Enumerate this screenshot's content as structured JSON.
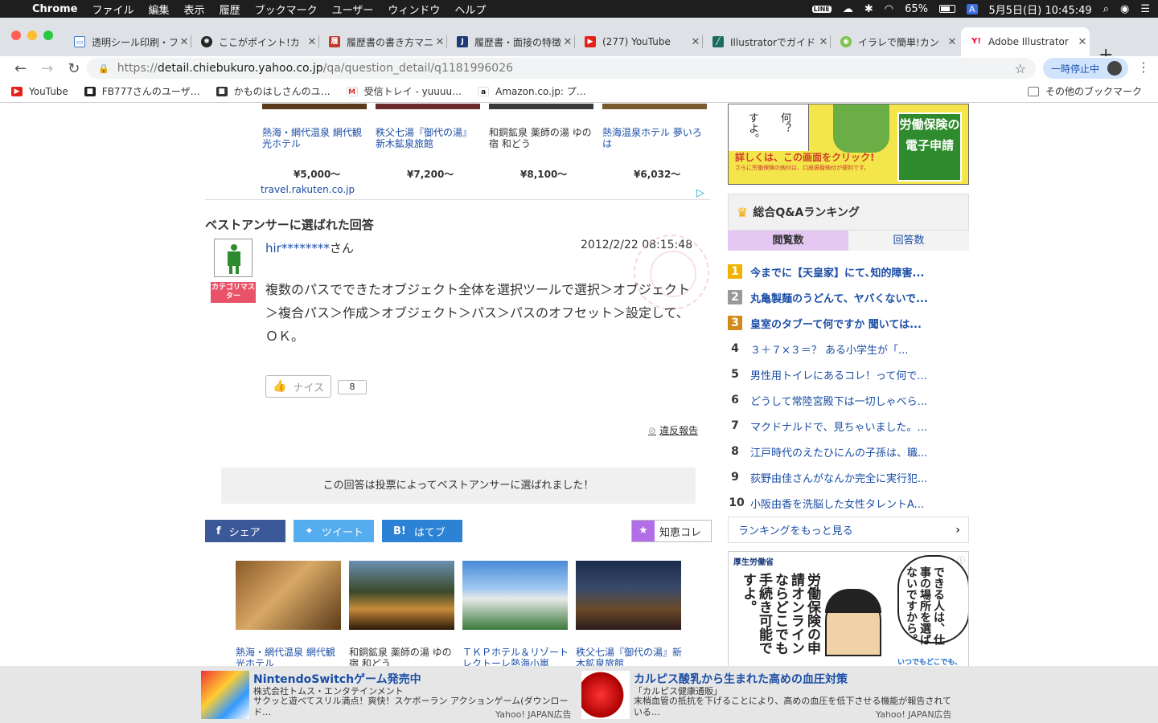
{
  "menubar": {
    "app": "Chrome",
    "items": [
      "ファイル",
      "編集",
      "表示",
      "履歴",
      "ブックマーク",
      "ユーザー",
      "ウィンドウ",
      "ヘルプ"
    ],
    "line_label": "LINE",
    "battery": "65%",
    "input_indicator": "A",
    "clock": "5月5日(日)  10:45:49"
  },
  "tabs": [
    {
      "title": "透明シール印刷・フ",
      "icon": "printing-favicon"
    },
    {
      "title": "ここがポイント!カ",
      "icon": "pinwheel-favicon"
    },
    {
      "title": "履歴書の書き方マニ",
      "icon": "resume-favicon"
    },
    {
      "title": "履歴書・面接の特徴",
      "icon": "j-favicon"
    },
    {
      "title": "(277) YouTube",
      "icon": "youtube-favicon"
    },
    {
      "title": "Illustratorでガイド",
      "icon": "illustrator-favicon"
    },
    {
      "title": "イラレで簡単!カン",
      "icon": "frog-favicon"
    },
    {
      "title": "Adobe Illustrator",
      "icon": "yahoo-favicon"
    }
  ],
  "address": {
    "scheme": "https://",
    "host": "detail.chiebukuro.yahoo.co.jp",
    "path": "/qa/question_detail/q1181996026"
  },
  "profile_button": "一時停止中",
  "bookmarks": [
    {
      "label": "YouTube",
      "icon": "youtube-icon"
    },
    {
      "label": "FB777さんのユーザ…",
      "icon": "fb777-icon"
    },
    {
      "label": "かものはしさんのユ…",
      "icon": "kamonohashi-icon"
    },
    {
      "label": "受信トレイ - yuuuu…",
      "icon": "gmail-icon"
    },
    {
      "label": "Amazon.co.jp: プ…",
      "icon": "amazon-icon"
    }
  ],
  "other_bookmarks": "その他のブックマーク",
  "travel_top": {
    "hotels": [
      {
        "name": "熱海・網代温泉 網代観光ホテル",
        "price": "¥5,000〜"
      },
      {
        "name": "秩父七湯『御代の湯』新木鉱泉旅館",
        "price": "¥7,200〜"
      },
      {
        "name": "和銅鉱泉 薬師の湯 ゆの宿 和どう",
        "price": "¥8,100〜"
      },
      {
        "name": "熱海温泉ホテル 夢いろは",
        "price": "¥6,032〜"
      }
    ],
    "source": "travel.rakuten.co.jp"
  },
  "best_answer": {
    "heading": "ベストアンサーに選ばれた回答",
    "badge": "カテゴリマスター",
    "user": "hir********",
    "suffix": "さん",
    "datetime": "2012/2/22  08:15:48",
    "body": "複数のパスでできたオブジェクト全体を選択ツールで選択＞オブジェクト＞複合パス＞作成＞オブジェクト＞パス＞パスのオフセット＞設定して、ＯＫ。",
    "nice_label": "ナイス",
    "nice_count": "8",
    "report": "違反報告",
    "vote_note": "この回答は投票によってベストアンサーに選ばれました！"
  },
  "share": {
    "facebook": "シェア",
    "twitter": "ツイート",
    "hatena": "はてブ",
    "hatena_mark": "B!",
    "chie": "知恵コレ"
  },
  "travel_bottom": [
    {
      "name": "熱海・網代温泉 網代観光ホテル"
    },
    {
      "name": "和銅鉱泉 薬師の湯 ゆの宿 和どう"
    },
    {
      "name": "ＴＫＰホテル＆リゾート レクトーレ熱海小嵐"
    },
    {
      "name": "秩父七湯『御代の湯』新木鉱泉旅館"
    }
  ],
  "ad_top": {
    "speech": "何？",
    "speech2": "すよ。",
    "cta": "詳しくは、この画面をクリック!",
    "small": "さらに労働保険の納付は、口座振替納付が便利です。",
    "badge": "労働保険の電子申請"
  },
  "ranking": {
    "title": "総合Q&Aランキング",
    "tab_views": "閲覧数",
    "tab_answers": "回答数",
    "items": [
      {
        "no": "1",
        "text": "今までに【天皇家】にて､知的障害..."
      },
      {
        "no": "2",
        "text": "丸亀製麺のうどんて、ヤバくないで..."
      },
      {
        "no": "3",
        "text": "皇室のタブーて何ですか 聞いては..."
      },
      {
        "no": "4",
        "text": "３＋７×３＝？ ある小学生が「..."
      },
      {
        "no": "5",
        "text": "男性用トイレにあるコレ！って何で..."
      },
      {
        "no": "6",
        "text": "どうして常陸宮殿下は一切しゃべら..."
      },
      {
        "no": "7",
        "text": "マクドナルドで、見ちゃいました。..."
      },
      {
        "no": "8",
        "text": "江戸時代のえたひにんの子孫は、職..."
      },
      {
        "no": "9",
        "text": "荻野由佳さんがなんか完全に実行犯..."
      },
      {
        "no": "10",
        "text": "小阪由香を洗脳した女性タレントA..."
      }
    ],
    "more": "ランキングをもっと見る"
  },
  "ad_mhlw": {
    "logo": "厚生労働省",
    "bubble": "できる人は、仕事の場所を選ばないですから。",
    "main": "労働保険の申請オンラインならどこでも手続き可能ですよ。",
    "footer": "いつでもどこでも、"
  },
  "footer_ads": [
    {
      "title": "NintendoSwitchゲーム発売中",
      "sponsor": "株式会社トムス・エンタテインメント",
      "desc": "サクッと遊べてスリル満点！爽快！スケボーラン アクションゲーム(ダウンロード…",
      "label": "Yahoo! JAPAN広告"
    },
    {
      "title": "カルピス酸乳から生まれた高めの血圧対策",
      "sponsor": "「カルピス健康通販」",
      "desc": "末梢血管の抵抗を下げることにより、高めの血圧を低下させる機能が報告されている…",
      "label": "Yahoo! JAPAN広告"
    }
  ]
}
